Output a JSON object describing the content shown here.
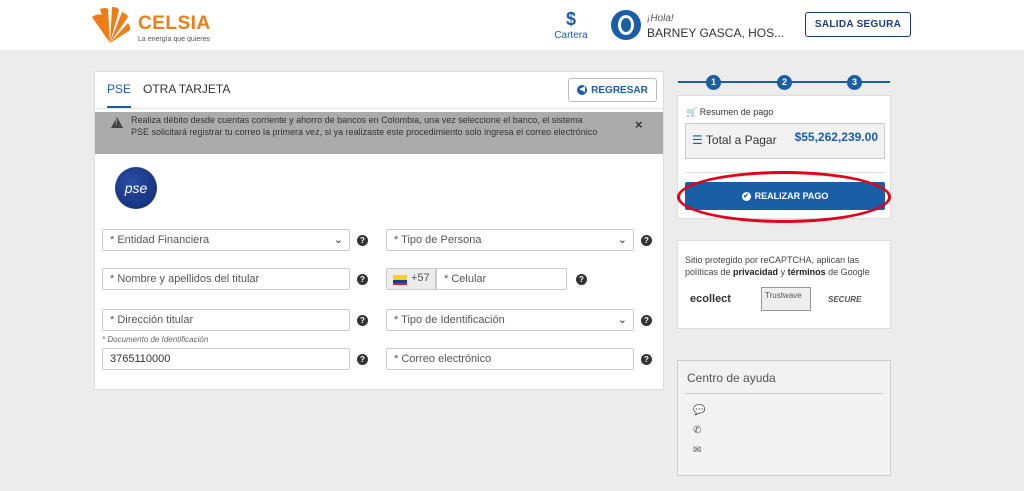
{
  "header": {
    "brand": "CELSIA",
    "tagline": "La energía que quieres",
    "cartera_icon": "$",
    "cartera_label": "Cartera",
    "greeting": "¡Hola!",
    "user_name": "BARNEY GASCA, HOS...",
    "logout_label": "SALIDA SEGURA"
  },
  "tabs": [
    {
      "label": "PSE",
      "active": true
    },
    {
      "label": "OTRA TARJETA",
      "active": false
    }
  ],
  "back_button": "REGRESAR",
  "alert": {
    "text": "Realiza débito desde cuentas corriente y ahorro de bancos en Colombia, una vez seleccione el banco, el sistema PSE solicitará registrar tu correo la primera vez, si ya realizaste este procedimiento solo ingresa el correo electrónico",
    "close": "×"
  },
  "pse_logo_text": "pse",
  "form": {
    "entidad": "* Entidad Financiera",
    "tipo_persona": "* Tipo de Persona",
    "nombre": "* Nombre y apellidos del titular",
    "phone_code": "+57",
    "celular": "* Celular",
    "direccion": "* Dirección titular",
    "tipo_id": "* Tipo de Identificación",
    "documento_label": "* Documento de Identificación",
    "documento_value": "3765110000",
    "correo": "* Correo electrónico",
    "help": "?",
    "chevron": "⌄"
  },
  "steps": [
    "1",
    "2",
    "3"
  ],
  "summary": {
    "title": "Resumen de pago",
    "total_label": "Total a Pagar",
    "total_value": "$55,262,239.00",
    "pay_button": "REALIZAR PAGO"
  },
  "security": {
    "text_pre": "Sitio protegido por reCAPTCHA, aplican las políticas de ",
    "privacy": "privacidad",
    "mid": " y ",
    "terms": "términos",
    "post": " de Google",
    "logo1": "ecollect",
    "logo2": "Trustwave",
    "logo3": "SECURE"
  },
  "help_center": {
    "title": "Centro de ayuda"
  },
  "colors": {
    "accent": "#1a5ea5",
    "brand_orange": "#f07c18",
    "highlight_red": "#e3001b"
  }
}
